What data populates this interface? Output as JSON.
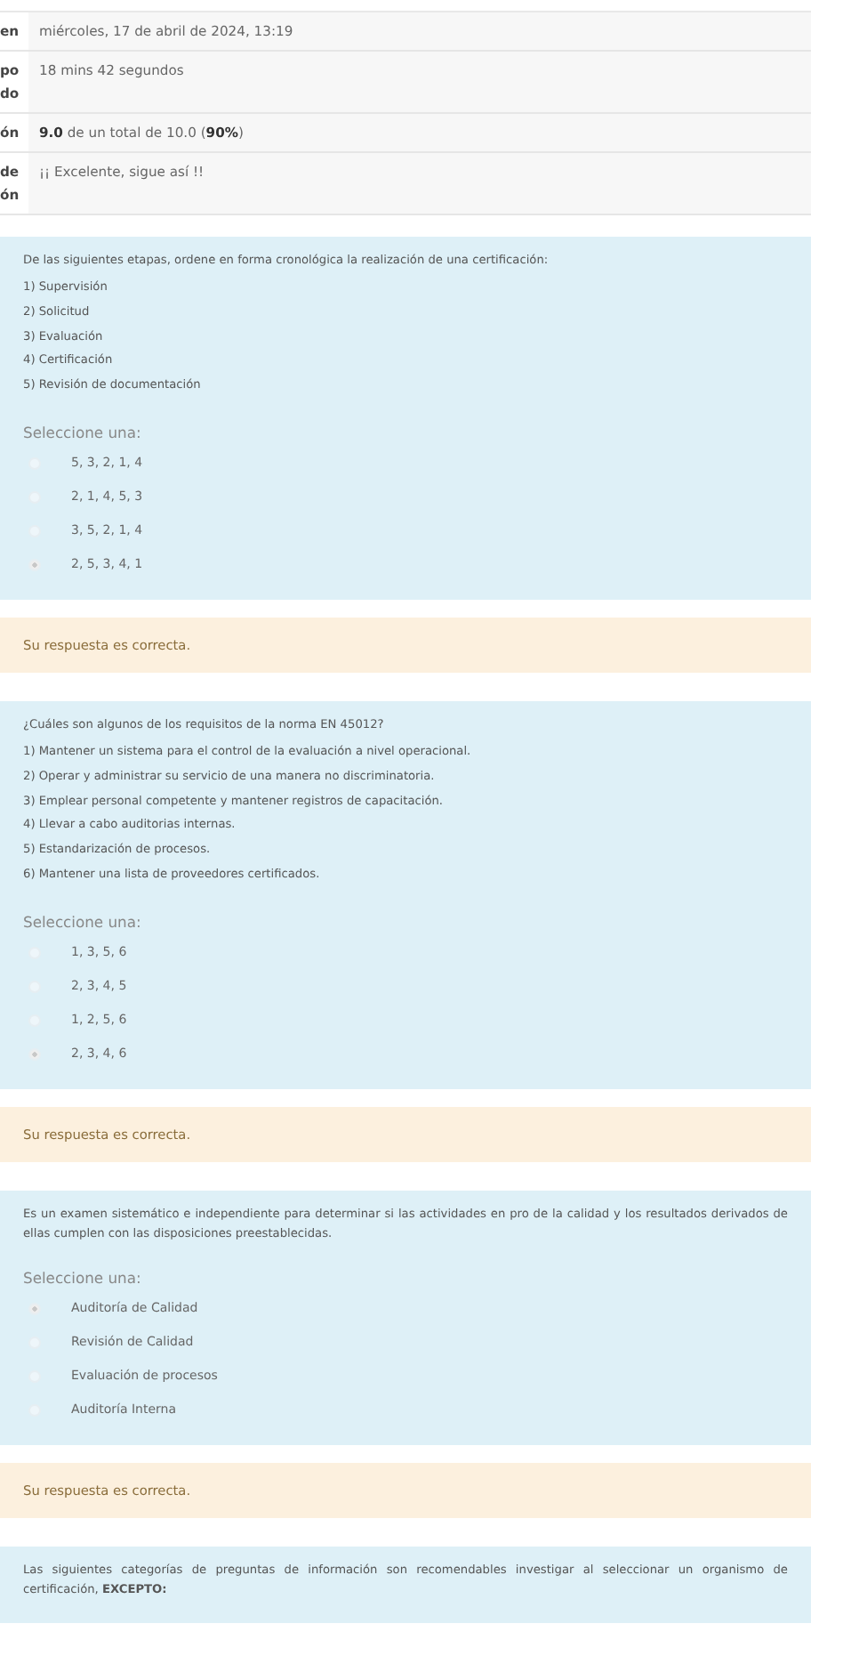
{
  "summary": [
    {
      "label_lines": [
        "en"
      ],
      "value": "miércoles, 17 de abril de 2024, 13:19"
    },
    {
      "label_lines": [
        "po",
        "do"
      ],
      "value": "18 mins 42 segundos"
    },
    {
      "label_lines": [
        "ón"
      ],
      "value": "**9.0** de un total de 10.0 (**90%**)"
    },
    {
      "label_lines": [
        "de",
        "ón"
      ],
      "value": "¡¡ Excelente, sigue así !!"
    }
  ],
  "questions": [
    {
      "prompt": "De las siguientes etapas, ordene en forma cronológica la realización de una certificación:",
      "items": [
        "1) Supervisión",
        "2) Solicitud",
        "3) Evaluación",
        "4) Certificación",
        "5) Revisión de documentación"
      ],
      "select_label": "Seleccione una:",
      "options": [
        {
          "text": "5, 3, 2, 1, 4",
          "selected": false
        },
        {
          "text": "2, 1, 4, 5, 3",
          "selected": false
        },
        {
          "text": "3, 5, 2, 1, 4",
          "selected": false
        },
        {
          "text": "2, 5, 3, 4, 1",
          "selected": true
        }
      ],
      "feedback": "Su respuesta es correcta."
    },
    {
      "prompt": "¿Cuáles son algunos de los requisitos de la norma EN 45012?",
      "items": [
        "1) Mantener un sistema para el control de la evaluación a nivel operacional.",
        "2) Operar y administrar su servicio de una manera no discriminatoria.",
        "3) Emplear personal competente y mantener registros de capacitación.",
        "4) Llevar a cabo auditorias internas.",
        "5) Estandarización de procesos.",
        "6) Mantener una lista de proveedores certificados."
      ],
      "select_label": "Seleccione una:",
      "options": [
        {
          "text": "1, 3, 5, 6",
          "selected": false
        },
        {
          "text": "2, 3, 4, 5",
          "selected": false
        },
        {
          "text": "1, 2, 5, 6",
          "selected": false
        },
        {
          "text": "2, 3, 4, 6",
          "selected": true
        }
      ],
      "feedback": "Su respuesta es correcta."
    },
    {
      "prompt": "Es un examen sistemático e independiente para determinar si las actividades en pro de la calidad y los resultados derivados de ellas cumplen con las disposiciones preestablecidas.",
      "select_label": "Seleccione una:",
      "options": [
        {
          "text": "Auditoría de Calidad",
          "selected": true
        },
        {
          "text": "Revisión de Calidad",
          "selected": false
        },
        {
          "text": "Evaluación de procesos",
          "selected": false
        },
        {
          "text": "Auditoría Interna",
          "selected": false
        }
      ],
      "feedback": "Su respuesta es correcta."
    },
    {
      "prompt": "Las siguientes categorías de preguntas de información son recomendables investigar al seleccionar un organismo de certificación, **EXCEPTO:**"
    }
  ]
}
